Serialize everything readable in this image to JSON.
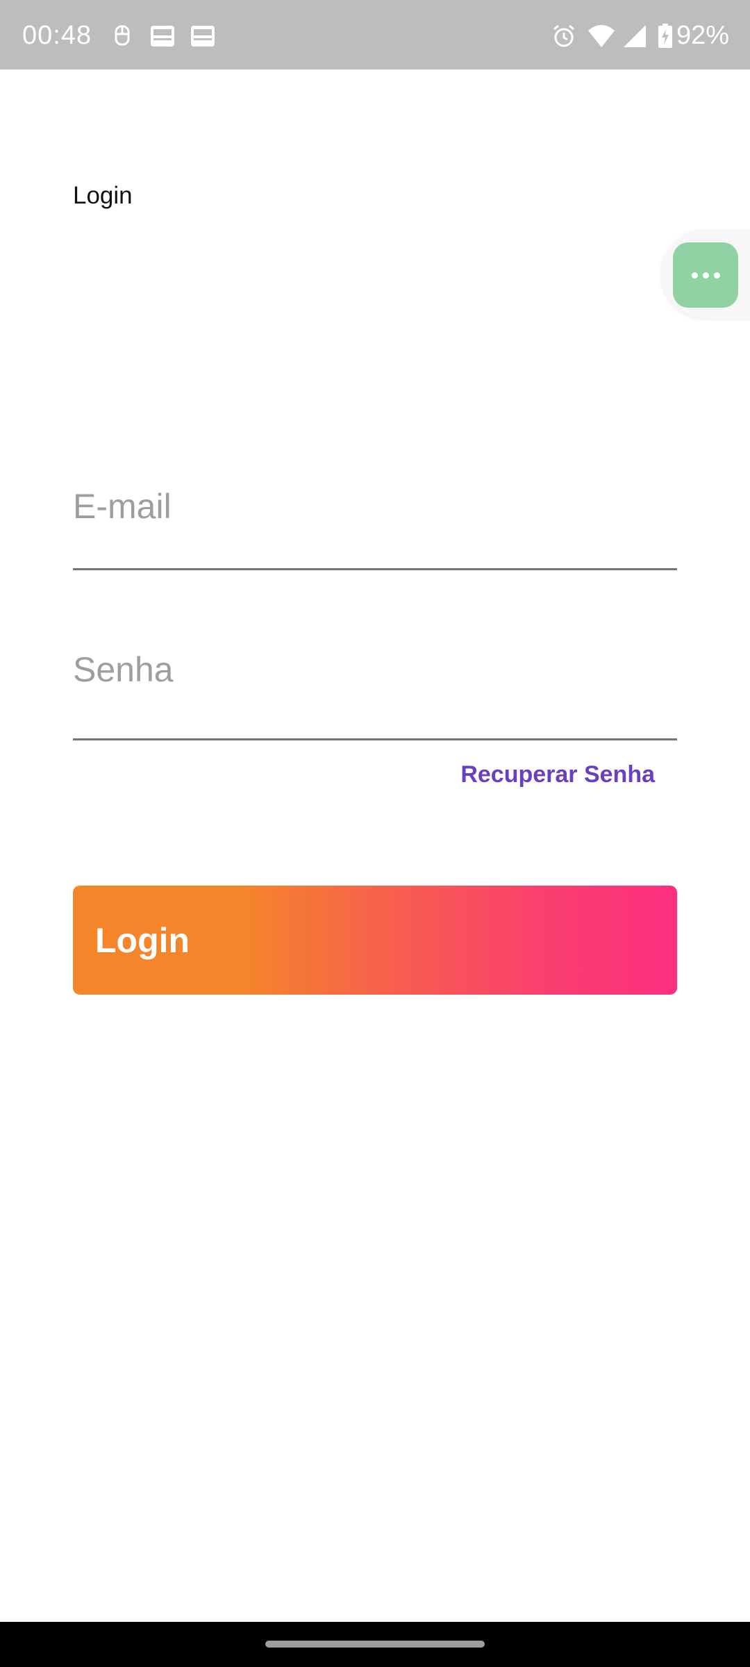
{
  "status_bar": {
    "time": "00:48",
    "battery_percent": "92%",
    "icons": [
      "notification-icon",
      "sim-card-icon",
      "sim-card-icon",
      "alarm-icon",
      "wifi-icon",
      "cell-signal-icon",
      "battery-charging-icon"
    ]
  },
  "page": {
    "title": "Login"
  },
  "floating_button": {
    "icon": "more-horizontal-icon",
    "color": "#90d2a3"
  },
  "form": {
    "email_placeholder": "E-mail",
    "email_value": "",
    "password_placeholder": "Senha",
    "password_value": "",
    "recover_label": "Recuperar Senha",
    "login_label": "Login"
  },
  "colors": {
    "link": "#6a3fc1",
    "gradient_start": "#f5852a",
    "gradient_end": "#fc2f80"
  }
}
